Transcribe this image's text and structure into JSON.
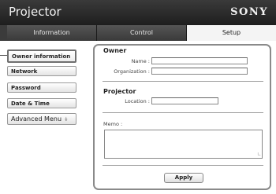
{
  "header": {
    "title": "Projector",
    "brand": "SONY"
  },
  "tabs": [
    {
      "label": "Information"
    },
    {
      "label": "Control"
    },
    {
      "label": "Setup"
    }
  ],
  "selected_tab": "Setup",
  "sidebar": {
    "items": [
      {
        "label": "Owner information"
      },
      {
        "label": "Network"
      },
      {
        "label": "Password"
      },
      {
        "label": "Date & Time"
      },
      {
        "label": "Advanced Menu"
      }
    ],
    "selected": "Owner information"
  },
  "owner": {
    "title": "Owner",
    "name_label": "Name :",
    "name_value": "",
    "organization_label": "Organization :",
    "organization_value": ""
  },
  "projector": {
    "title": "Projector",
    "location_label": "Location :",
    "location_value": ""
  },
  "memo": {
    "label": "Memo :",
    "value": ""
  },
  "apply_label": "Apply",
  "colors": {
    "header_bg": "#2a2a2a",
    "tab_bar": "#3b3b3b",
    "active_tab": "#f4f4f4",
    "panel_border": "#8a8a8a"
  }
}
